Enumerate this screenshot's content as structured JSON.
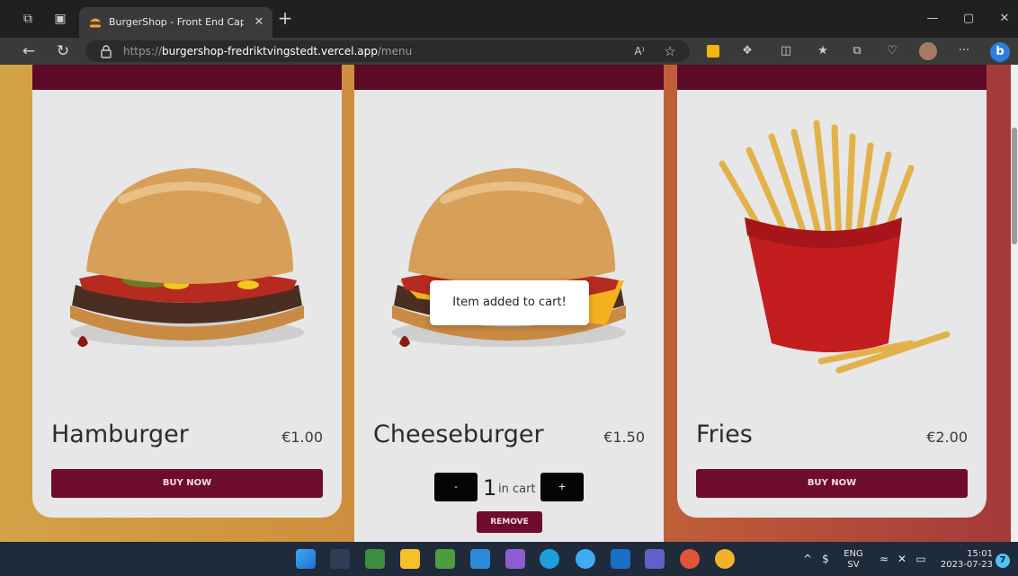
{
  "browser": {
    "tab_title": "BurgerShop - Front End Capstone",
    "url_prefix": "https://",
    "url_host": "burgershop-fredriktvingstedt.vercel.app",
    "url_path": "/menu",
    "read_aloud_label": "A⁾",
    "more_label": "···"
  },
  "menu": {
    "items": [
      {
        "name": "Hamburger",
        "price": "€1.00",
        "button": "BUY NOW"
      },
      {
        "name": "Cheeseburger",
        "price": "€1.50",
        "qty": "1",
        "qty_label": "in cart",
        "minus": "-",
        "plus": "+",
        "remove": "REMOVE"
      },
      {
        "name": "Fries",
        "price": "€2.00",
        "button": "BUY NOW"
      }
    ]
  },
  "toast": {
    "message": "Item added to cart!"
  },
  "taskbar": {
    "language": "ENG",
    "layout": "SV",
    "time": "15:01",
    "date": "2023-07-23",
    "notifications": "7"
  },
  "colors": {
    "brand_dark": "#5c0a25",
    "button": "#6e0b2e",
    "card": "#e7e7e7"
  }
}
